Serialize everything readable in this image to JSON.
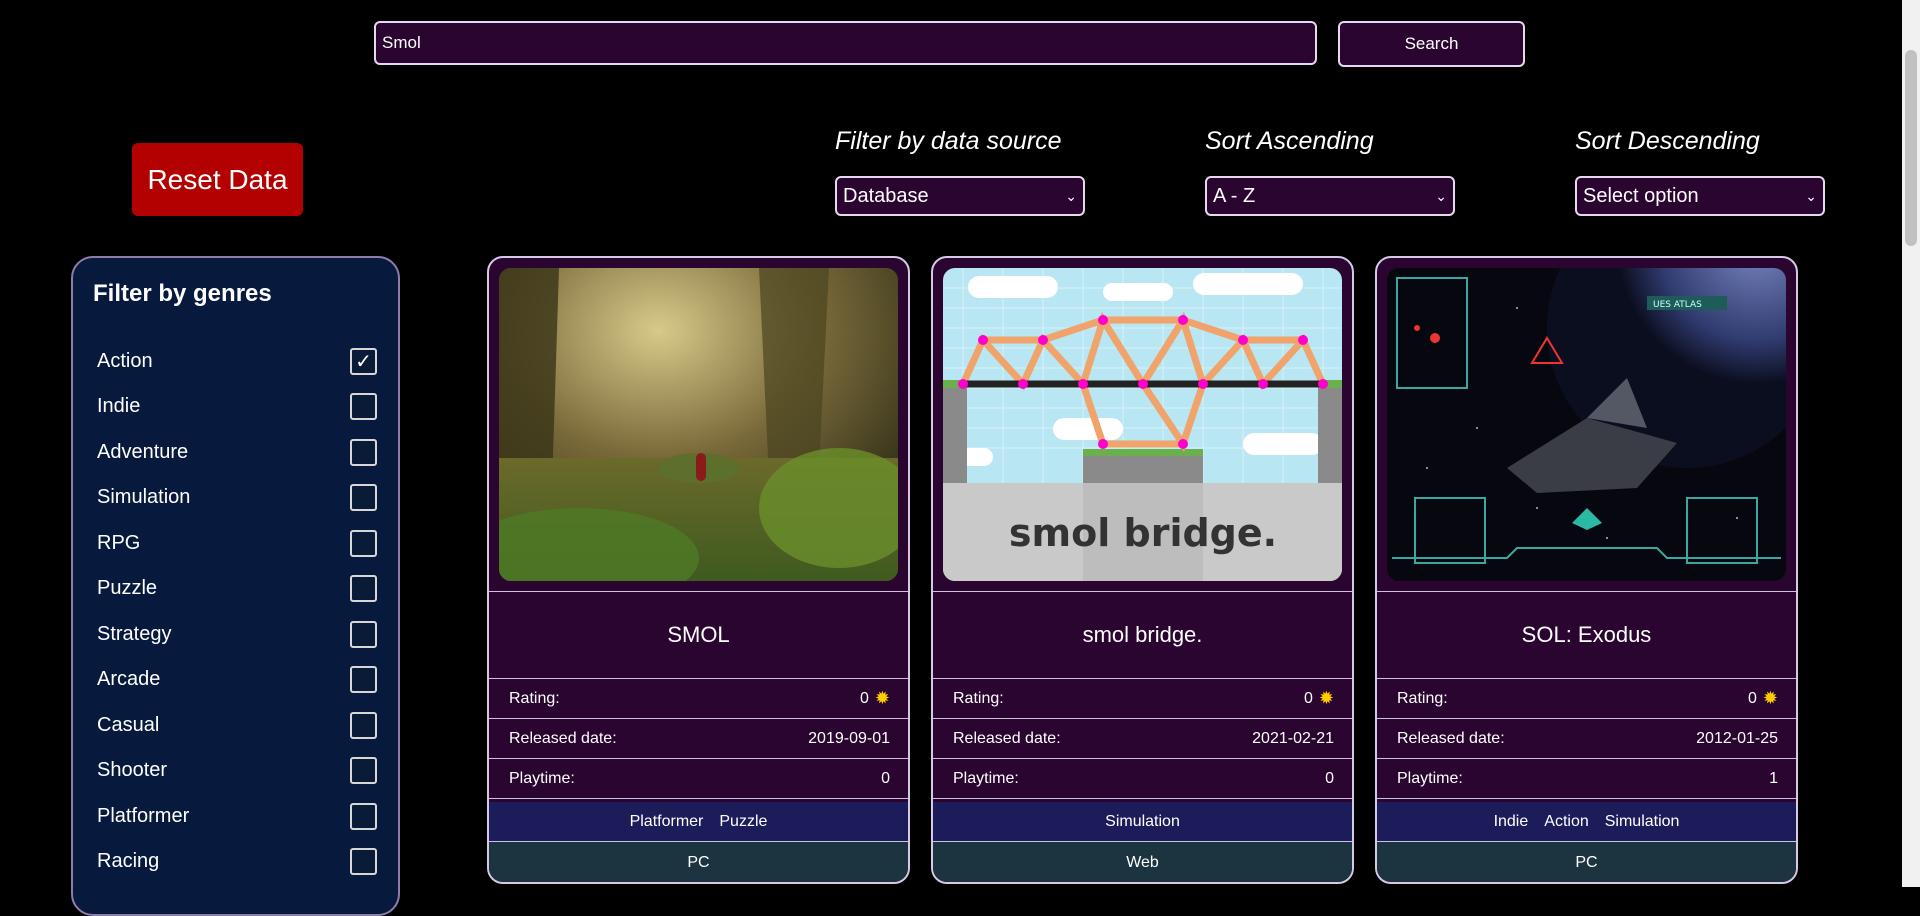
{
  "search": {
    "value": "Smol",
    "button_label": "Search"
  },
  "reset_label": "Reset Data",
  "filters": {
    "source": {
      "label": "Filter by data source",
      "selected": "Database"
    },
    "asc": {
      "label": "Sort Ascending",
      "selected": "A - Z"
    },
    "desc": {
      "label": "Sort Descending",
      "selected": "Select option"
    }
  },
  "genre_panel": {
    "title": "Filter by genres",
    "genres": [
      {
        "label": "Action",
        "checked": true,
        "mark": "✓"
      },
      {
        "label": "Indie",
        "checked": false,
        "mark": ""
      },
      {
        "label": "Adventure",
        "checked": false,
        "mark": ""
      },
      {
        "label": "Simulation",
        "checked": false,
        "mark": ""
      },
      {
        "label": "RPG",
        "checked": false,
        "mark": ""
      },
      {
        "label": "Puzzle",
        "checked": false,
        "mark": ""
      },
      {
        "label": "Strategy",
        "checked": false,
        "mark": ""
      },
      {
        "label": "Arcade",
        "checked": false,
        "mark": ""
      },
      {
        "label": "Casual",
        "checked": false,
        "mark": ""
      },
      {
        "label": "Shooter",
        "checked": false,
        "mark": ""
      },
      {
        "label": "Platformer",
        "checked": false,
        "mark": ""
      },
      {
        "label": "Racing",
        "checked": false,
        "mark": ""
      }
    ]
  },
  "labels": {
    "rating": "Rating:",
    "released": "Released date:",
    "playtime": "Playtime:"
  },
  "icons": {
    "rating": "sun-icon",
    "dropdown": "chevron-down-icon",
    "check": "checkmark-icon"
  },
  "colors": {
    "accent": "#2a0530",
    "reset": "#b30000",
    "panel": "#071a3d",
    "genres_bar": "#1c1c5a",
    "platform_bar": "#1b3440"
  },
  "games": [
    {
      "name": "SMOL",
      "rating": "0",
      "released": "2019-09-01",
      "playtime": "0",
      "genres": [
        "Platformer",
        "Puzzle"
      ],
      "platform": "PC"
    },
    {
      "name": "smol bridge.",
      "rating": "0",
      "released": "2021-02-21",
      "playtime": "0",
      "genres": [
        "Simulation"
      ],
      "platform": "Web",
      "image_text": "smol bridge."
    },
    {
      "name": "SOL: Exodus",
      "rating": "0",
      "released": "2012-01-25",
      "playtime": "1",
      "genres": [
        "Indie",
        "Action",
        "Simulation"
      ],
      "platform": "PC",
      "image_text": "UES ATLAS"
    }
  ]
}
